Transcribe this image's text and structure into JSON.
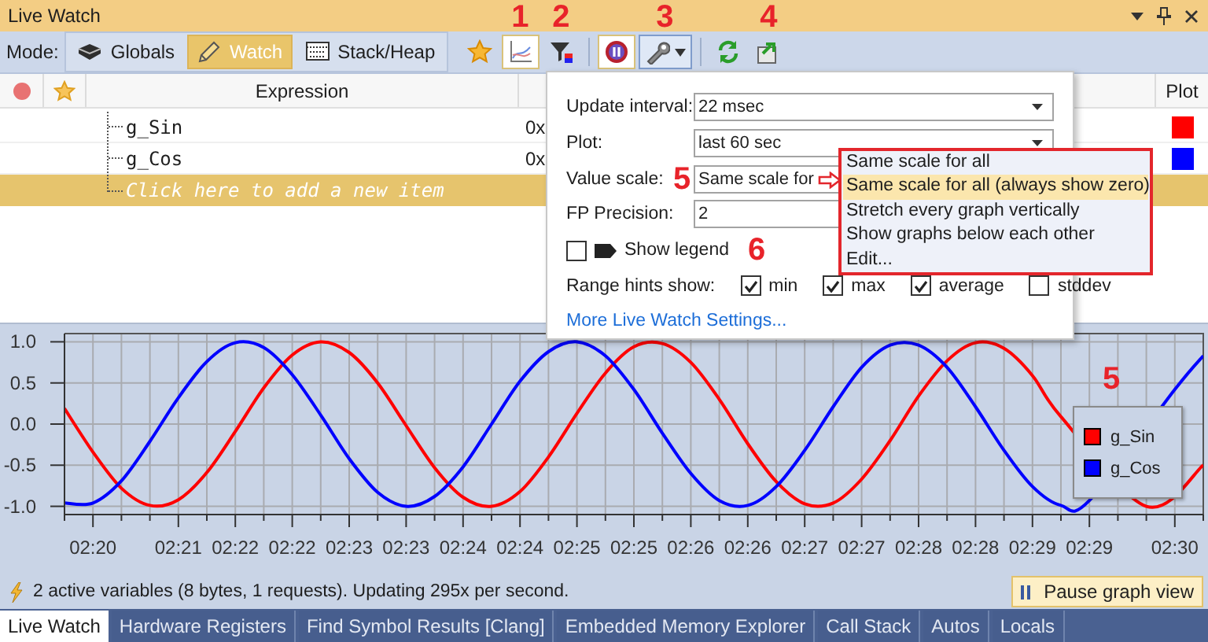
{
  "window": {
    "title": "Live Watch"
  },
  "toolbar": {
    "mode_label": "Mode:",
    "modes": [
      {
        "label": "Globals",
        "selected": false
      },
      {
        "label": "Watch",
        "selected": true
      },
      {
        "label": "Stack/Heap",
        "selected": false
      }
    ],
    "annotations": [
      "1",
      "2",
      "3",
      "4"
    ]
  },
  "table": {
    "columns": [
      "Expression",
      "Plot"
    ],
    "rows": [
      {
        "expression": "g_Sin",
        "value": "0x",
        "color": "#ff0000"
      },
      {
        "expression": "g_Cos",
        "value": "0x",
        "color": "#0000ff"
      }
    ],
    "new_item_placeholder": "Click here to add a new item"
  },
  "popup": {
    "fields": [
      {
        "label": "Update interval:",
        "value": "22 msec"
      },
      {
        "label": "Plot:",
        "value": "last 60 sec"
      },
      {
        "label": "Value scale:",
        "value": "Same scale for",
        "annotation": "5"
      },
      {
        "label": "FP Precision:",
        "value": "2"
      }
    ],
    "show_legend": {
      "label": "Show legend",
      "checked": false,
      "annotation": "6"
    },
    "range_hints": {
      "label": "Range hints show:",
      "options": [
        {
          "label": "min",
          "checked": true
        },
        {
          "label": "max",
          "checked": true
        },
        {
          "label": "average",
          "checked": true
        },
        {
          "label": "stddev",
          "checked": false
        }
      ]
    },
    "link": "More Live Watch Settings...",
    "value_scale_menu": [
      {
        "label": "Same scale for all",
        "selected": false
      },
      {
        "label": "Same scale for all (always show zero)",
        "selected": true
      },
      {
        "label": "Stretch every graph vertically",
        "selected": false
      },
      {
        "label": "Show graphs below each other",
        "selected": false
      },
      {
        "label": "Edit...",
        "selected": false
      }
    ]
  },
  "chart": {
    "legend_annotation": "5",
    "chart_data": {
      "type": "line",
      "categories": [
        null,
        "02:20",
        null,
        null,
        "02:21",
        null,
        "02:22",
        null,
        "02:22",
        null,
        "02:23",
        null,
        "02:23",
        null,
        "02:24",
        null,
        "02:24",
        null,
        "02:25",
        null,
        "02:25",
        null,
        "02:26",
        null,
        "02:26",
        null,
        "02:27",
        null,
        "02:27",
        null,
        "02:28",
        null,
        "02:28",
        null,
        "02:29",
        null,
        "02:29",
        null,
        null,
        "02:30",
        null
      ],
      "ylim": [
        -1.1,
        1.1
      ],
      "grid": true,
      "yticks": [
        {
          "value": 1,
          "label": "1.0"
        },
        {
          "value": 0.5,
          "label": "0.5"
        },
        {
          "value": 0,
          "label": "0.0"
        },
        {
          "value": -0.5,
          "label": "-0.5"
        },
        {
          "value": -1,
          "label": "-1.0"
        }
      ],
      "series": [
        {
          "name": "g_Sin",
          "color": "#ff0000",
          "values": [
            0.19,
            -0.34,
            -0.78,
            -0.99,
            -0.92,
            -0.59,
            -0.09,
            0.44,
            0.84,
            1.0,
            0.87,
            0.5,
            -0.02,
            -0.53,
            -0.89,
            -1.0,
            -0.82,
            -0.4,
            0.13,
            0.62,
            0.94,
            0.98,
            0.75,
            0.3,
            -0.24,
            -0.7,
            -0.97,
            -0.96,
            -0.67,
            -0.2,
            0.34,
            0.77,
            0.99,
            0.92,
            0.59,
            0.09,
            null,
            null,
            -1.0,
            null,
            -0.5
          ]
        },
        {
          "name": "g_Cos",
          "color": "#0000ff",
          "values": [
            -0.96,
            -0.96,
            -0.69,
            -0.21,
            0.32,
            0.76,
            0.99,
            0.93,
            0.6,
            0.11,
            -0.42,
            -0.83,
            -1.0,
            -0.88,
            -0.52,
            0.0,
            0.52,
            0.88,
            1.0,
            0.83,
            0.42,
            -0.11,
            -0.6,
            -0.93,
            -0.99,
            -0.76,
            -0.32,
            0.21,
            0.69,
            0.96,
            0.96,
            0.69,
            0.21,
            -0.32,
            -0.76,
            -0.99,
            -0.93,
            null,
            null,
            0.42,
            0.83
          ]
        }
      ]
    }
  },
  "status": {
    "text": "2 active variables (8 bytes, 1 requests). Updating 295x per second.",
    "pause_button": "Pause graph view"
  },
  "bottom_tabs": [
    {
      "label": "Live Watch",
      "selected": true
    },
    {
      "label": "Hardware Registers",
      "selected": false
    },
    {
      "label": "Find Symbol Results [Clang]",
      "selected": false
    },
    {
      "label": "Embedded Memory Explorer",
      "selected": false
    },
    {
      "label": "Call Stack",
      "selected": false
    },
    {
      "label": "Autos",
      "selected": false
    },
    {
      "label": "Locals",
      "selected": false
    }
  ]
}
